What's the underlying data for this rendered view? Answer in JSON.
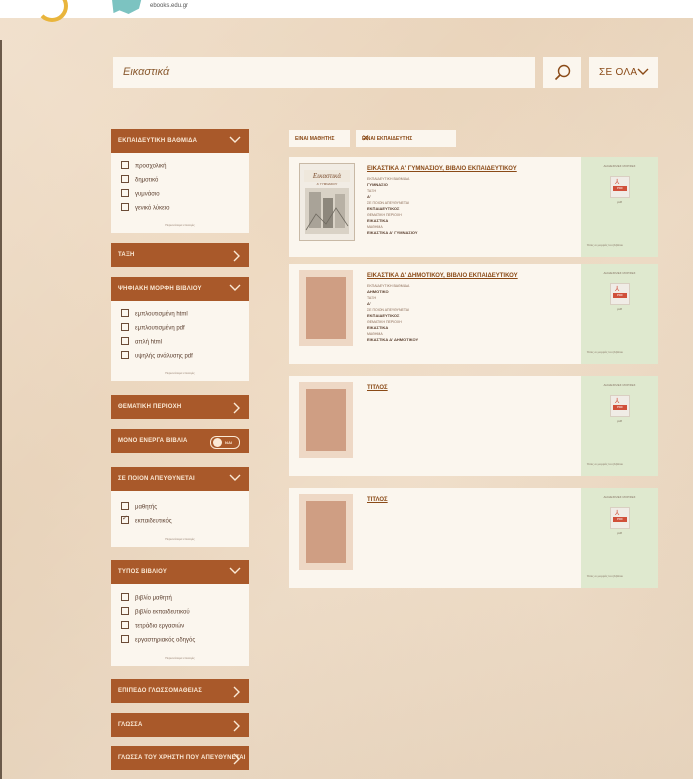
{
  "header": {
    "site_url": "ebooks.edu.gr"
  },
  "search": {
    "value": "Εικαστικά",
    "scope_label": "ΣΕ ΟΛΑ"
  },
  "sidebar": {
    "educational_level": {
      "title": "ΕΚΠΑΙΔΕΥΤΙΚΗ ΒΑΘΜΙΔΑ",
      "options": [
        "προσχολική",
        "δημοτικό",
        "γυμνάσιο",
        "γενικό λύκειο"
      ],
      "more": "Περισσότερα επιλογές"
    },
    "class": {
      "title": "ΤΑΞΗ"
    },
    "digital_form": {
      "title": "ΨΗΦΙΑΚΗ ΜΟΡΦΗ ΒΙΒΛΙΟΥ",
      "options": [
        "εμπλουτισμένη html",
        "εμπλουτισμένη pdf",
        "απλή html",
        "υψηλής ανάλυσης pdf"
      ],
      "more": "Περισσότερα επιλογές"
    },
    "subject_area": {
      "title": "ΘΕΜΑΤΙΚΗ ΠΕΡΙΟΧΗ"
    },
    "active_only": {
      "title": "ΜΟΝΟ ΕΝΕΡΓΑ ΒΙΒΛΙΑ",
      "toggle_text": "ΝΑΙ"
    },
    "audience": {
      "title": "ΣΕ ΠΟΙΟΝ ΑΠΕΥΘΥΝΕΤΑΙ",
      "options": [
        {
          "label": "μαθητής",
          "checked": false
        },
        {
          "label": "εκπαιδευτικός",
          "checked": true
        }
      ],
      "more": "Περισσότερα επιλογές"
    },
    "book_type": {
      "title": "ΤΥΠΟΣ ΒΙΒΛΙΟΥ",
      "options": [
        "βιβλίο μαθητή",
        "βιβλίο εκπαιδευτικού",
        "τετράδιο εργασιών",
        "εργαστηριακός οδηγός"
      ],
      "more": "Περισσότερα επιλογές"
    },
    "language_level": {
      "title": "ΕΠΙΠΕΔΟ ΓΛΩΣΣΟΜΑΘΕΙΑΣ"
    },
    "language": {
      "title": "ΓΛΩΣΣΑ"
    },
    "user_language": {
      "title": "ΓΛΩΣΣΑ ΤΟΥ ΧΡΗΣΤΗ ΠΟΥ ΑΠΕΥΘΥΝΕΤΑΙ"
    }
  },
  "chips": [
    {
      "label": "ΕΙΝΑΙ ΜΑΘΗΤΗΣ",
      "active": false
    },
    {
      "label": "ΕΙΝΑΙ ΕΚΠΑΙΔΕΥΤΗΣ",
      "active": true
    }
  ],
  "results": [
    {
      "title": "ΕΙΚΑΣΤΙΚΑ Α' ΓΥΜΝΑΣΙΟΥ, ΒΙΒΛΙΟ ΕΚΠΑΙΔΕΥΤΙΚΟΥ",
      "level_label": "ΕΚΠΑΙΔΕΥΤΙΚΗ ΒΑΘΜΙΔΑ",
      "level": "ΓΥΜΝΑΣΙΟ",
      "class_label": "ΤΑΞΗ",
      "class": "Α'",
      "audience_label": "ΣΕ ΠΟΙΟΝ ΑΠΕΥΘΥΝΕΤΑΙ",
      "audience": "ΕΚΠΑΙΔΕΥΤΙΚΟΣ",
      "subject_label": "ΘΕΜΑΤΙΚΗ ΠΕΡΙΟΧΗ",
      "subject": "ΕΙΚΑΣΤΙΚΑ",
      "course_label": "ΜΑΘΗΜΑ",
      "course": "ΕΙΚΑΣΤΙΚΑ Α' ΓΥΜΝΑΣΙΟΥ",
      "side_header": "ΔΙΑΘΕΣΙΜΕΣ ΜΟΡΦΕΣ",
      "file_label": "PDF",
      "format": "pdf",
      "side_footer": "Όλες οι μορφές του βιβλίου",
      "has_cover": true,
      "cover_title": "Εικαστικά",
      "cover_subtitle": "Α' ΓΥΜΝΑΣΙΟΥ"
    },
    {
      "title": "ΕΙΚΑΣΤΙΚΑ Δ' ΔΗΜΟΤΙΚΟΥ, ΒΙΒΛΙΟ ΕΚΠΑΙΔΕΥΤΙΚΟΥ",
      "level_label": "ΕΚΠΑΙΔΕΥΤΙΚΗ ΒΑΘΜΙΔΑ",
      "level": "ΔΗΜΟΤΙΚΟ",
      "class_label": "ΤΑΞΗ",
      "class": "Δ'",
      "audience_label": "ΣΕ ΠΟΙΟΝ ΑΠΕΥΘΥΝΕΤΑΙ",
      "audience": "ΕΚΠΑΙΔΕΥΤΙΚΟΣ",
      "subject_label": "ΘΕΜΑΤΙΚΗ ΠΕΡΙΟΧΗ",
      "subject": "ΕΙΚΑΣΤΙΚΑ",
      "course_label": "ΜΑΘΗΜΑ",
      "course": "ΕΙΚΑΣΤΙΚΑ Δ' ΔΗΜΟΤΙΚΟΥ",
      "side_header": "ΔΙΑΘΕΣΙΜΕΣ ΜΟΡΦΕΣ",
      "file_label": "PDF",
      "format": "pdf",
      "side_footer": "Όλες οι μορφές του βιβλίου",
      "has_cover": false
    },
    {
      "title": "ΤΙΤΛΟΣ",
      "side_header": "ΔΙΑΘΕΣΙΜΕΣ ΜΟΡΦΕΣ",
      "file_label": "PDF",
      "format": "pdf",
      "side_footer": "Όλες οι μορφές του βιβλίου",
      "has_cover": false
    },
    {
      "title": "ΤΙΤΛΟΣ",
      "side_header": "ΔΙΑΘΕΣΙΜΕΣ ΜΟΡΦΕΣ",
      "file_label": "PDF",
      "format": "pdf",
      "side_footer": "Όλες οι μορφές του βιβλίου",
      "has_cover": false
    }
  ],
  "colors": {
    "accent": "#a9592a",
    "panel": "#fbf6ee",
    "side": "#dfe9cf",
    "background": "#ecd6bc",
    "pdf_red": "#d04f3a"
  }
}
